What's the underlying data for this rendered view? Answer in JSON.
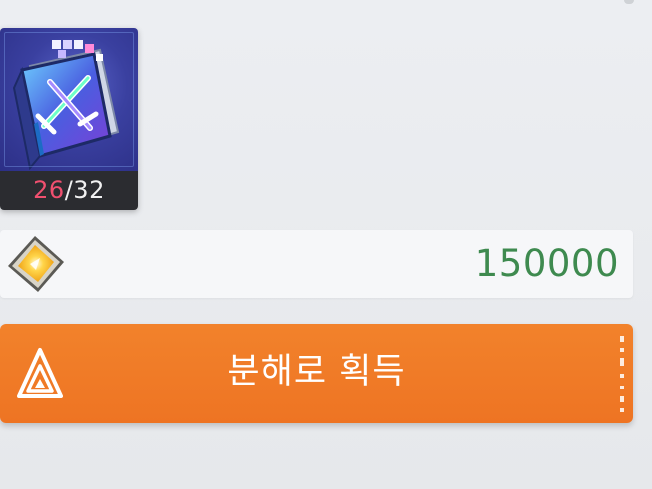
{
  "item": {
    "icon": "skill-book-icon",
    "count_current": "26",
    "count_separator": "/",
    "count_max": "32",
    "count_current_color": "#f0506f"
  },
  "reward": {
    "icon": "gold-crystal-icon",
    "amount": "150000",
    "amount_color": "#3e8a4f"
  },
  "action_button": {
    "icon": "triangle-arrow-icon",
    "label": "분해로 획득",
    "color": "#f0792a"
  }
}
